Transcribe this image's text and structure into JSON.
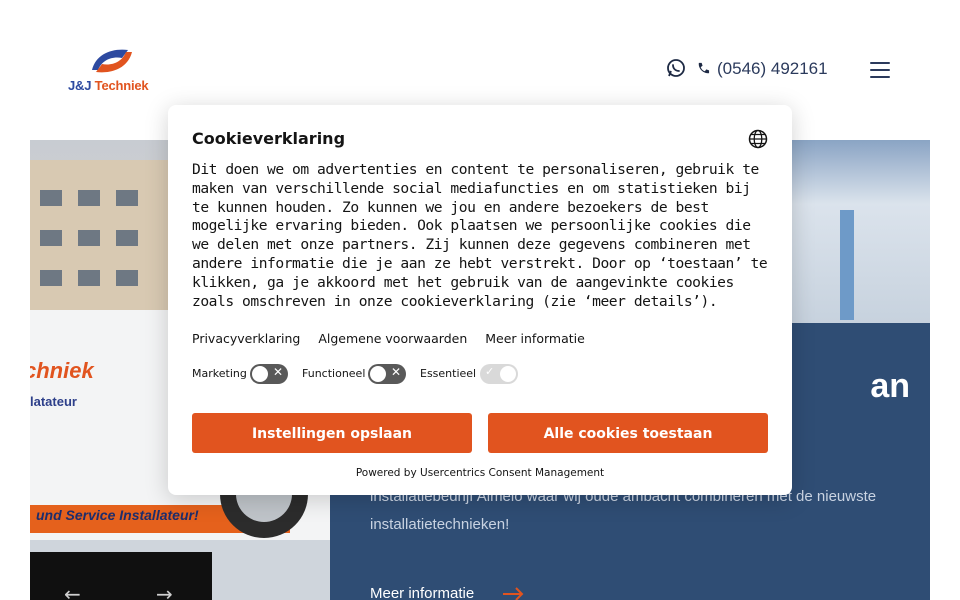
{
  "header": {
    "logo_amp": "J&J",
    "logo_name": "Techniek",
    "phone": "(0546) 492161"
  },
  "hero": {
    "title_visible": "an",
    "text": "installatiebedrijf Almelo waar wij oude ambacht combineren met de nieuwste installatietechnieken!",
    "link_label": "Meer informatie",
    "van_brand": "chniek",
    "van_subtitle": "latateur",
    "van_stripe": "und Service Installateur!"
  },
  "cookie_dialog": {
    "title": "Cookieverklaring",
    "body": "Dit doen we om advertenties en content te personaliseren, gebruik te maken van verschillende social mediafuncties en om statistieken bij te kunnen houden. Zo kunnen we jou en andere bezoekers de best mogelijke ervaring bieden. Ook plaatsen we persoonlijke cookies die we delen met onze partners. Zij kunnen deze gegevens combineren met andere informatie die je aan ze hebt verstrekt. Door op ‘toestaan’ te klikken, ga je akkoord met het gebruik van de aangevinkte cookies zoals omschreven in onze cookieverklaring (zie ‘meer details’).",
    "links": [
      "Privacyverklaring",
      "Algemene voorwaarden",
      "Meer informatie"
    ],
    "toggles": [
      {
        "label": "Marketing",
        "state": "off"
      },
      {
        "label": "Functioneel",
        "state": "off"
      },
      {
        "label": "Essentieel",
        "state": "on-disabled"
      }
    ],
    "save_button": "Instellingen opslaan",
    "accept_all_button": "Alle cookies toestaan",
    "powered_by": "Powered by Usercentrics Consent Management"
  },
  "colors": {
    "accent": "#e1541f",
    "hero_blue": "#2f4d74",
    "toggle_off": "#595959"
  },
  "icons": [
    "whatsapp-icon",
    "phone-icon",
    "menu-icon",
    "globe-icon",
    "arrow-right-icon",
    "chevron-left-icon",
    "chevron-right-icon"
  ]
}
